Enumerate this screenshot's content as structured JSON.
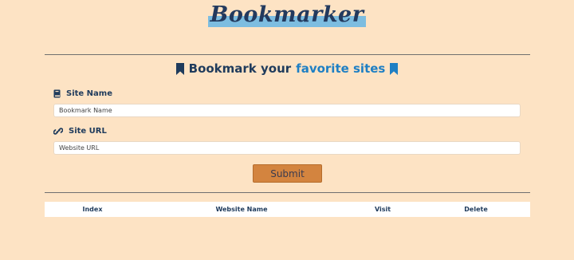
{
  "logo": {
    "text": "Bookmarker"
  },
  "heading": {
    "part1": "Bookmark your",
    "part2": "favorite sites",
    "icon": "bookmark-icon"
  },
  "form": {
    "site_name": {
      "label": "Site Name",
      "placeholder": "Bookmark Name",
      "icon": "book-icon"
    },
    "site_url": {
      "label": "Site URL",
      "placeholder": "Website URL",
      "icon": "link-icon"
    },
    "submit_label": "Submit"
  },
  "table": {
    "columns": [
      "Index",
      "Website Name",
      "Visit",
      "Delete"
    ]
  },
  "colors": {
    "background": "#fde3c4",
    "text": "#1f3b5c",
    "accent": "#1e7fc4",
    "button": "#d3843f",
    "logo_highlight": "#7dbde0"
  }
}
